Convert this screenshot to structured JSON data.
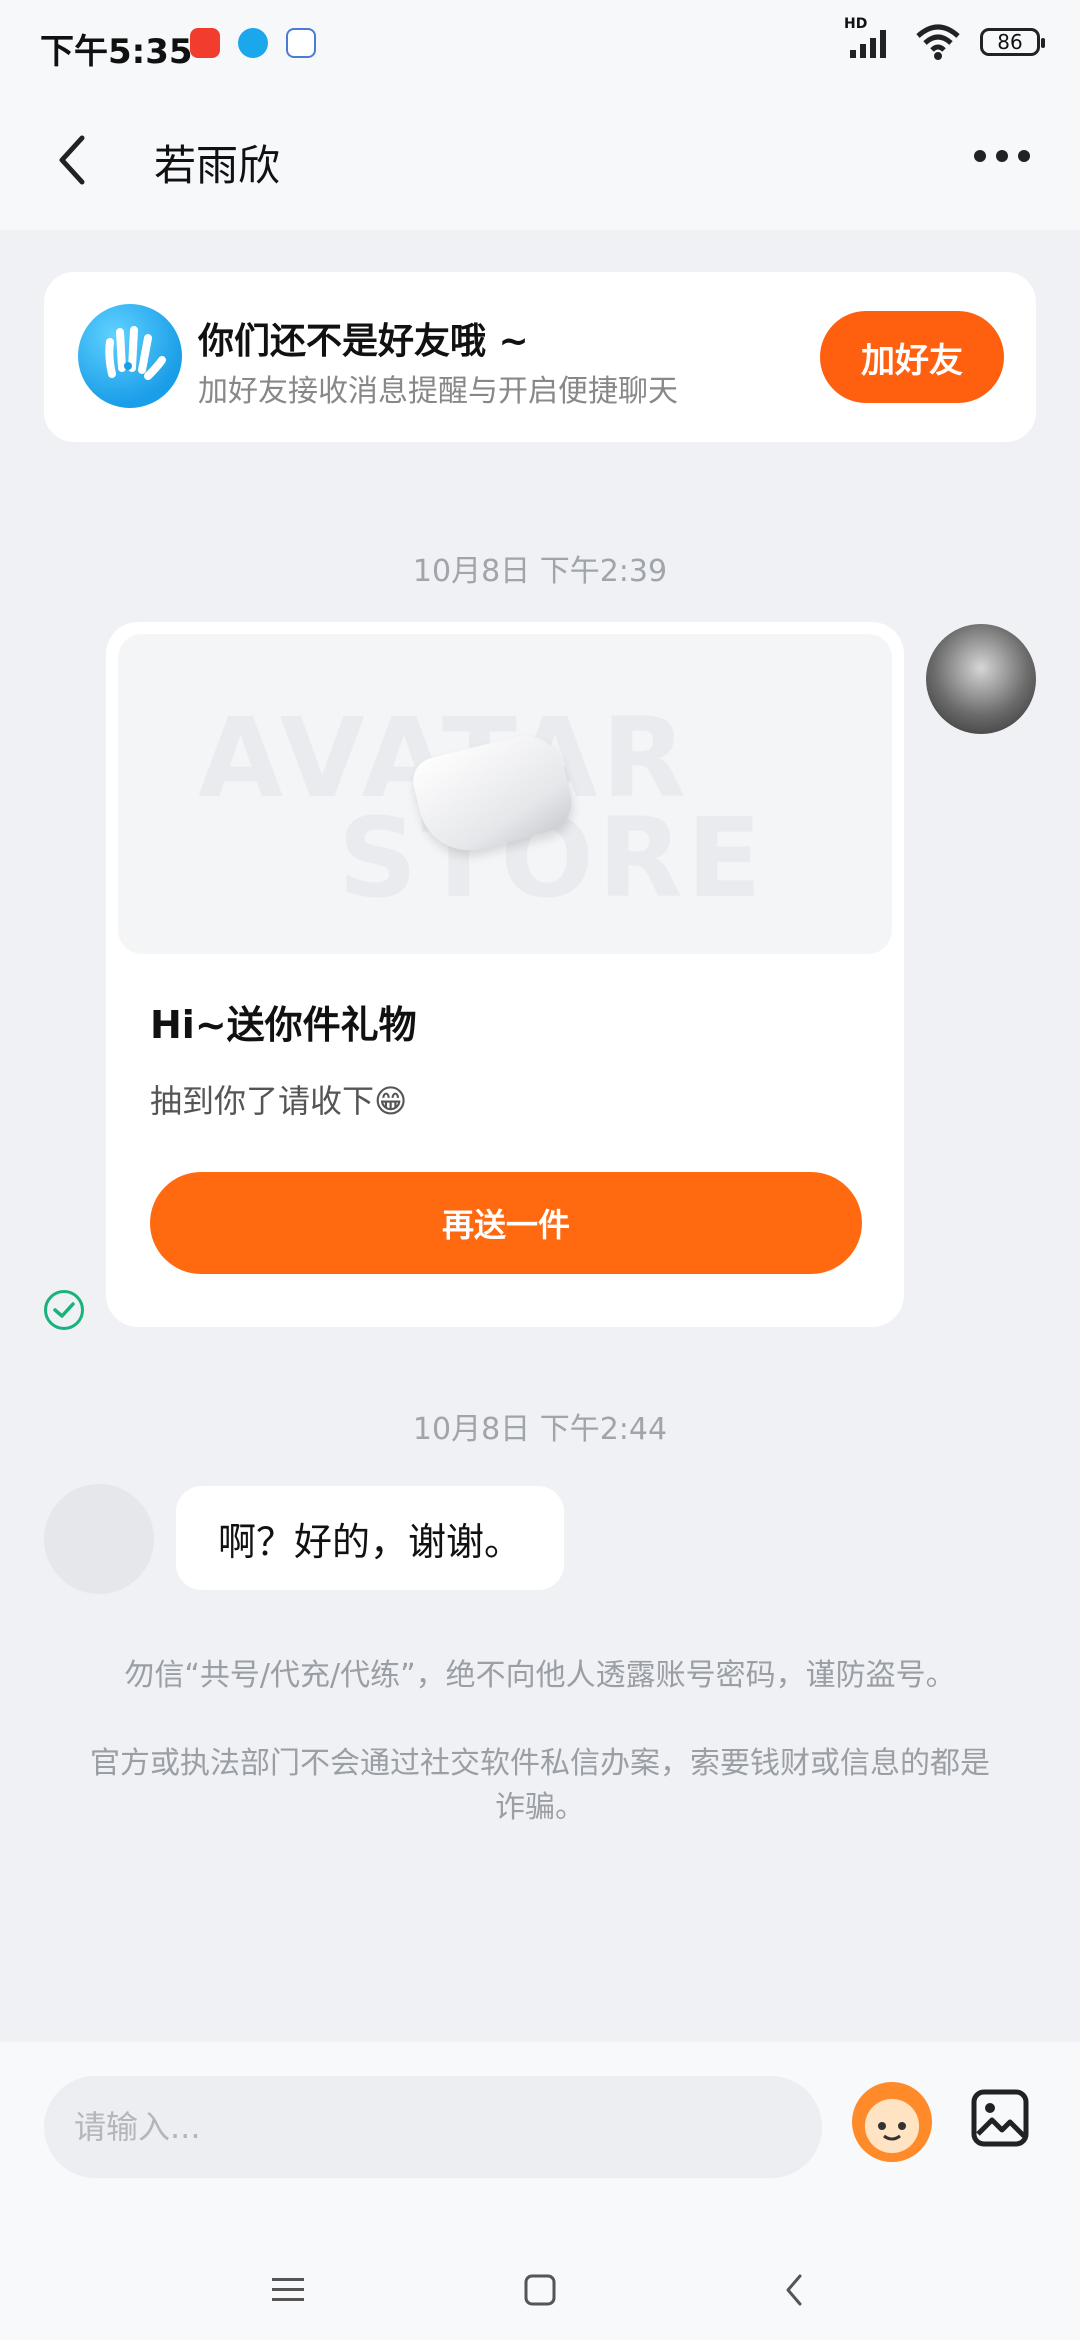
{
  "status_bar": {
    "time": "下午5:35",
    "network": "HD",
    "battery": "86"
  },
  "header": {
    "title": "若雨欣"
  },
  "friend_banner": {
    "title": "你们还不是好友哦 ~",
    "subtitle": "加好友接收消息提醒与开启便捷聊天",
    "button_label": "加好友"
  },
  "messages": [
    {
      "timestamp": "10月8日 下午2:39",
      "type": "gift",
      "image_watermark_top": "AVATAR",
      "image_watermark_bottom": "STORE",
      "title": "Hi~送你件礼物",
      "description": "抽到你了请收下😁",
      "button_label": "再送一件"
    },
    {
      "timestamp": "10月8日 下午2:44",
      "type": "text",
      "text": "啊？好的，谢谢。"
    }
  ],
  "notices": [
    "勿信“共号/代充/代练”，绝不向他人透露账号密码，谨防盗号。",
    "官方或执法部门不会通过社交软件私信办案，索要钱财或信息的都是诈骗。"
  ],
  "input": {
    "placeholder": "请输入..."
  },
  "colors": {
    "accent": "#ff6a10",
    "background": "#eff1f4",
    "check": "#19b37a"
  }
}
